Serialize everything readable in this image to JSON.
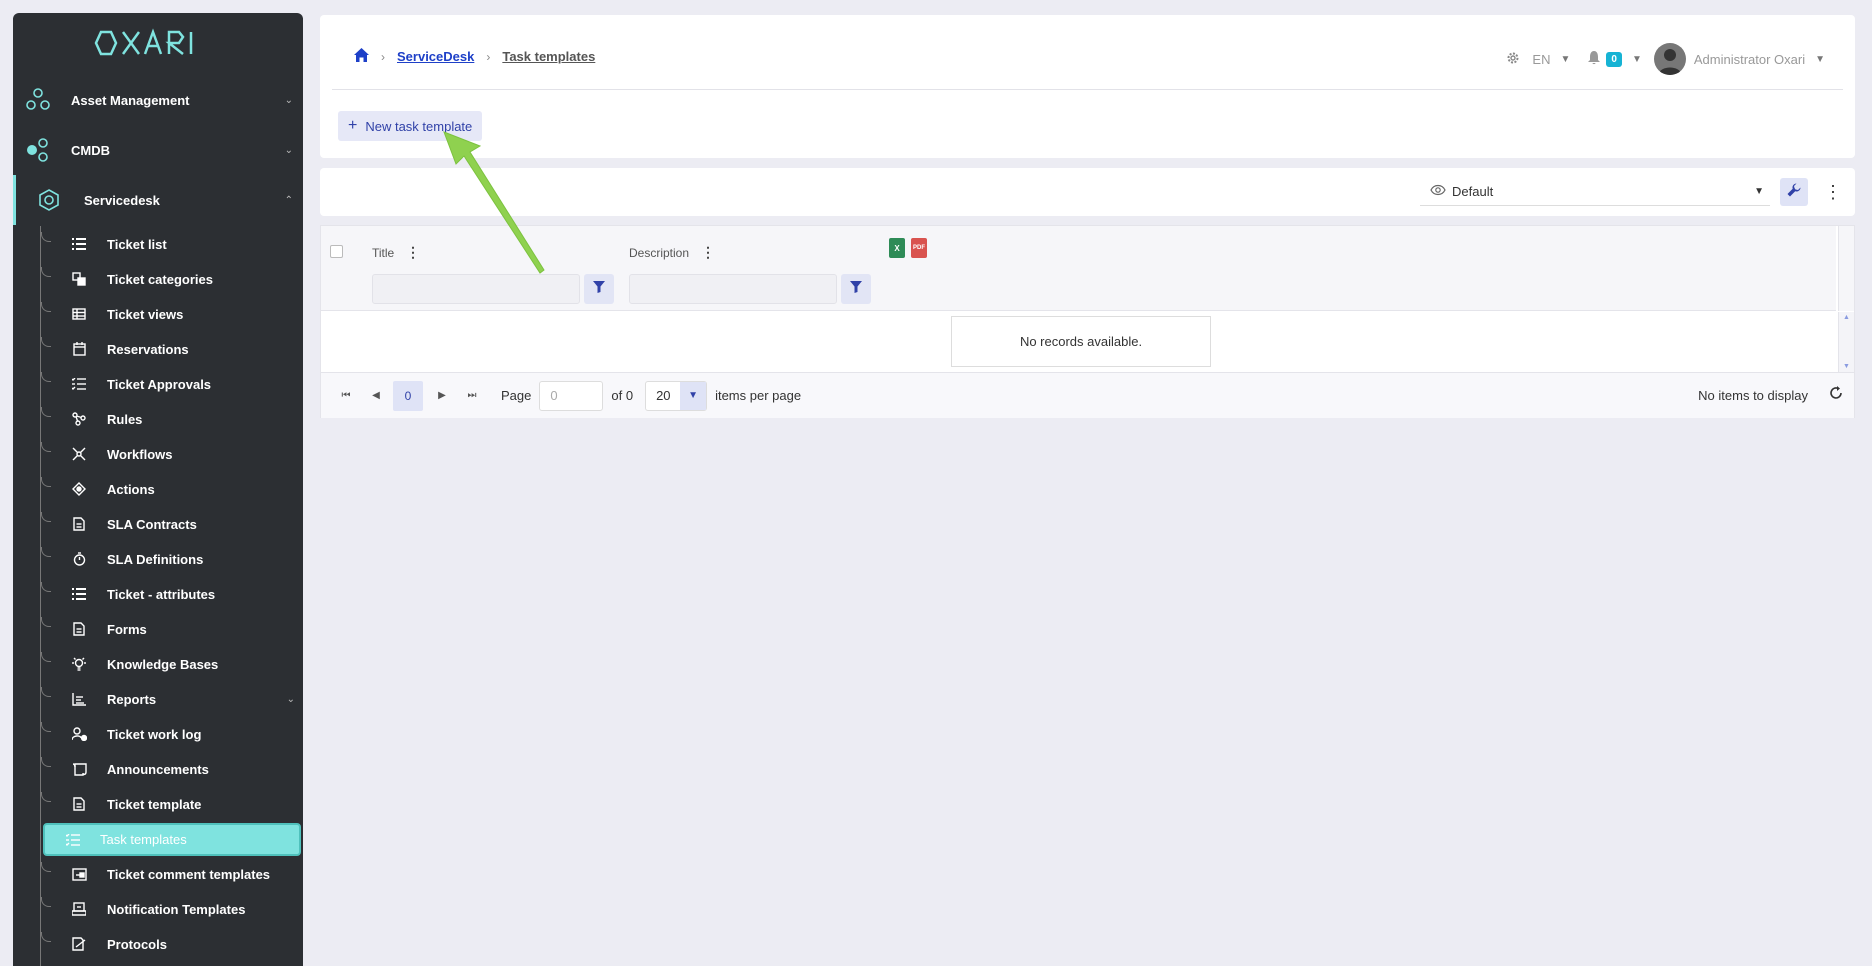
{
  "app": {
    "logo": "OXARI"
  },
  "sidebar": {
    "top_items": [
      {
        "label": "Asset Management",
        "icon": "hexagon-cluster-icon"
      },
      {
        "label": "CMDB",
        "icon": "hexagon-nodes-icon"
      },
      {
        "label": "Servicedesk",
        "icon": "servicedesk-icon"
      }
    ],
    "sub_items": [
      {
        "label": "Ticket list",
        "icon": "list-icon"
      },
      {
        "label": "Ticket categories",
        "icon": "categories-icon"
      },
      {
        "label": "Ticket views",
        "icon": "table-icon"
      },
      {
        "label": "Reservations",
        "icon": "calendar-icon"
      },
      {
        "label": "Ticket Approvals",
        "icon": "checklist-icon"
      },
      {
        "label": "Rules",
        "icon": "rules-icon"
      },
      {
        "label": "Workflows",
        "icon": "workflow-icon"
      },
      {
        "label": "Actions",
        "icon": "actions-icon"
      },
      {
        "label": "SLA Contracts",
        "icon": "document-icon"
      },
      {
        "label": "SLA Definitions",
        "icon": "stopwatch-icon"
      },
      {
        "label": "Ticket - attributes",
        "icon": "list-icon"
      },
      {
        "label": "Forms",
        "icon": "document-icon"
      },
      {
        "label": "Knowledge Bases",
        "icon": "lightbulb-icon"
      },
      {
        "label": "Reports",
        "icon": "chart-icon"
      },
      {
        "label": "Ticket work log",
        "icon": "user-clock-icon"
      },
      {
        "label": "Announcements",
        "icon": "scroll-icon"
      },
      {
        "label": "Ticket template",
        "icon": "document-icon"
      },
      {
        "label": "Task templates",
        "icon": "checklist-icon"
      },
      {
        "label": "Ticket comment templates",
        "icon": "comment-template-icon"
      },
      {
        "label": "Notification Templates",
        "icon": "notification-template-icon"
      },
      {
        "label": "Protocols",
        "icon": "protocol-icon"
      }
    ]
  },
  "header": {
    "breadcrumb": {
      "link": "ServiceDesk",
      "current": "Task templates"
    },
    "language": "EN",
    "notification_count": "0",
    "user_name": "Administrator Oxari",
    "new_button_label": "New task template"
  },
  "toolbar": {
    "view_name": "Default"
  },
  "grid": {
    "columns": [
      {
        "title": "Title"
      },
      {
        "title": "Description"
      }
    ],
    "empty_text": "No records available.",
    "export": {
      "excel": "X",
      "pdf": "PDF"
    }
  },
  "pager": {
    "current_page": "0",
    "page_label": "Page",
    "page_input": "0",
    "of_label": "of 0",
    "page_size": "20",
    "items_per_page_label": "items per page",
    "status": "No items to display"
  },
  "colors": {
    "accent": "#7fe3df",
    "sidebar_bg": "#2c2f33",
    "primary": "#3142a8",
    "arrow": "#8fd14f"
  }
}
